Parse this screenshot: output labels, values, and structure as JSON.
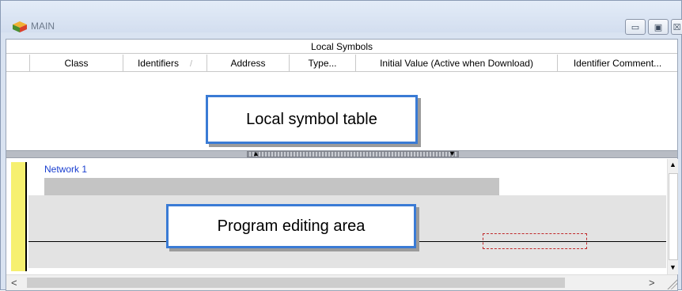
{
  "window": {
    "title": "MAIN",
    "minimize_glyph": "▭",
    "maximize_glyph": "▣",
    "close_glyph": "☒"
  },
  "symbols": {
    "header": "Local Symbols",
    "columns": [
      {
        "label": "Class"
      },
      {
        "label": "Identifiers",
        "sort_glyph": "/"
      },
      {
        "label": "Address"
      },
      {
        "label": "Type..."
      },
      {
        "label": "Initial Value (Active when Download)"
      },
      {
        "label": "Identifier Comment..."
      }
    ]
  },
  "callouts": {
    "symbol_table": "Local symbol table",
    "program_area": "Program editing area"
  },
  "splitter": {
    "up_glyph": "▲",
    "down_glyph": "▼"
  },
  "editor": {
    "network_label": "Network 1"
  },
  "scrollbars": {
    "up_glyph": "▲",
    "down_glyph": "▼",
    "left_glyph": "<",
    "right_glyph": ">"
  },
  "colors": {
    "accent_border": "#3a7bd5",
    "network_label": "#1a3fd0",
    "left_bar": "#f6f070",
    "cursor": "#c0282a"
  }
}
